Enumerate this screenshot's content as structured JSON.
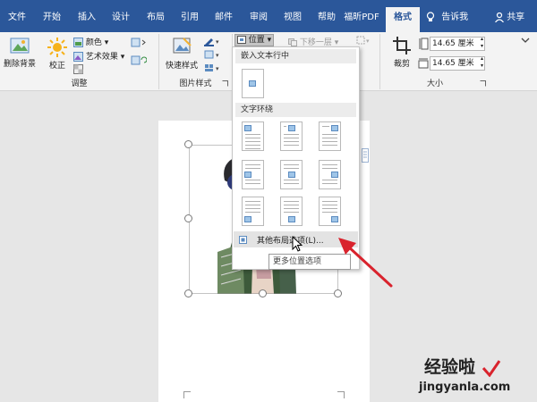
{
  "tabs": [
    "文件",
    "开始",
    "插入",
    "设计",
    "布局",
    "引用",
    "邮件",
    "审阅",
    "视图",
    "帮助",
    "福昕PDF",
    "格式"
  ],
  "active_tab": "格式",
  "tell_me": "告诉我",
  "share": "共享",
  "ribbon": {
    "remove_bg": "删除背景",
    "correct": "校正",
    "color": "颜色",
    "artistic": "艺术效果",
    "group_adjust": "调整",
    "quick_styles": "快速样式",
    "group_styles": "图片样式",
    "position": "位置",
    "send_backward": "下移一层",
    "crop": "裁剪",
    "height": "14.65 厘米",
    "width": "14.65 厘米",
    "group_size": "大小"
  },
  "position_menu": {
    "section_inline": "嵌入文本行中",
    "section_wrap": "文字环绕",
    "more_options": "其他布局选项(L)...",
    "tooltip": "更多位置选项"
  },
  "watermark": {
    "brand": "经验啦",
    "url": "jingyanla.com"
  },
  "colors": {
    "accent": "#2b579a",
    "arrow": "#d9232d"
  }
}
